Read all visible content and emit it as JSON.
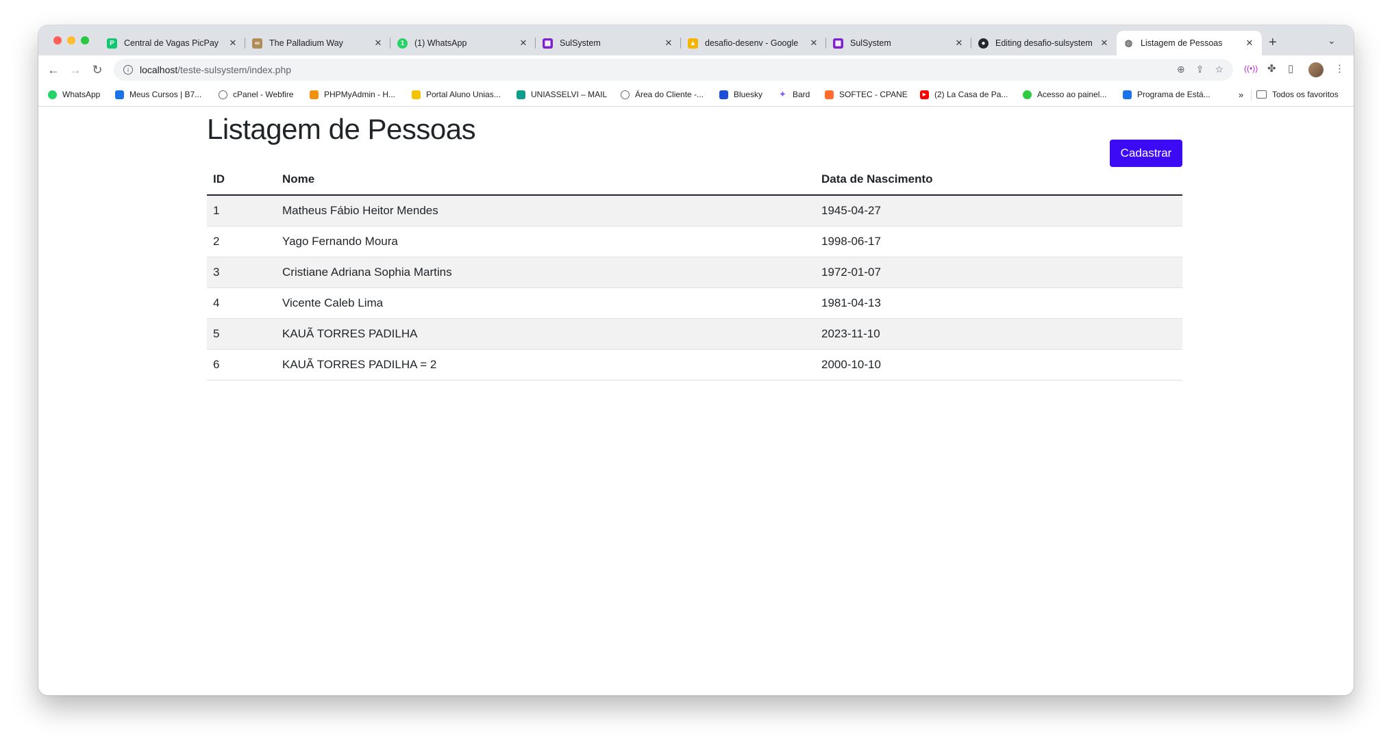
{
  "browser": {
    "tabs": [
      {
        "title": "Central de Vagas PicPay",
        "fav_color": "#11c76f",
        "fav_glyph": "P"
      },
      {
        "title": "The Palladium Way",
        "fav_color": "#b08d57",
        "fav_glyph": "∞"
      },
      {
        "title": "(1) WhatsApp",
        "fav_color": "#25d366",
        "fav_glyph": "1"
      },
      {
        "title": "SulSystem",
        "fav_color": "#7e22ce",
        "fav_glyph": "▦"
      },
      {
        "title": "desafio-desenv - Google",
        "fav_color": "#f4b400",
        "fav_glyph": "▲"
      },
      {
        "title": "SulSystem",
        "fav_color": "#7e22ce",
        "fav_glyph": "▦"
      },
      {
        "title": "Editing desafio-sulsystem",
        "fav_color": "#24292f",
        "fav_glyph": "●"
      },
      {
        "title": "Listagem de Pessoas",
        "fav_color": "#5f6368",
        "fav_glyph": "◍",
        "active": true
      }
    ],
    "url": {
      "host": "localhost",
      "path": "/teste-sulsystem/index.php"
    },
    "bookmarks": [
      {
        "label": "WhatsApp",
        "color": "#25d366"
      },
      {
        "label": "Meus Cursos | B7...",
        "color": "#1a73e8"
      },
      {
        "label": "cPanel - Webfire",
        "color": "#5f6368"
      },
      {
        "label": "PHPMyAdmin - H...",
        "color": "#f29111"
      },
      {
        "label": "Portal Aluno Unias...",
        "color": "#f5c400"
      },
      {
        "label": "UNIASSELVI – MAIL",
        "color": "#0f9d8c"
      },
      {
        "label": "Área do Cliente -...",
        "color": "#5f6368"
      },
      {
        "label": "Bluesky",
        "color": "#1d4ed8"
      },
      {
        "label": "Bard",
        "color": "#8b5cf6"
      },
      {
        "label": "SOFTEC - CPANE",
        "color": "#ff6c2c"
      },
      {
        "label": "(2) La Casa de Pa...",
        "color": "#ff0000"
      },
      {
        "label": "Acesso ao painel...",
        "color": "#2ecc40"
      },
      {
        "label": "Programa de Está...",
        "color": "#1a73e8"
      }
    ],
    "bookmarks_overflow": "»",
    "all_bookmarks": "Todos os favoritos"
  },
  "page": {
    "title": "Listagem de Pessoas",
    "add_button": "Cadastrar",
    "accent_color": "#3d0af5",
    "columns": [
      "ID",
      "Nome",
      "Data de Nascimento"
    ],
    "rows": [
      {
        "id": "1",
        "nome": "Matheus Fábio Heitor Mendes",
        "nascimento": "1945-04-27"
      },
      {
        "id": "2",
        "nome": "Yago Fernando Moura",
        "nascimento": "1998-06-17"
      },
      {
        "id": "3",
        "nome": "Cristiane Adriana Sophia Martins",
        "nascimento": "1972-01-07"
      },
      {
        "id": "4",
        "nome": "Vicente Caleb Lima",
        "nascimento": "1981-04-13"
      },
      {
        "id": "5",
        "nome": "KAUÃ TORRES PADILHA",
        "nascimento": "2023-11-10"
      },
      {
        "id": "6",
        "nome": "KAUÃ TORRES PADILHA = 2",
        "nascimento": "2000-10-10"
      }
    ]
  }
}
